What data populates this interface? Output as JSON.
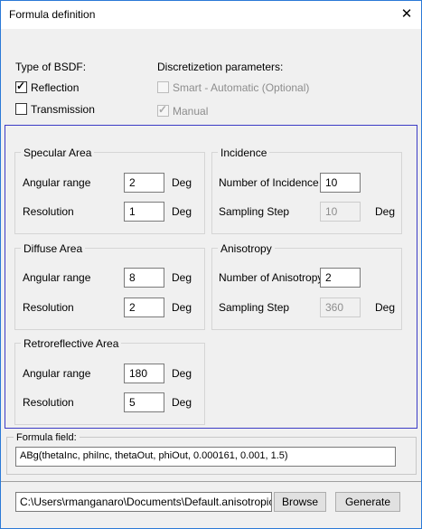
{
  "window": {
    "title": "Formula definition",
    "close_glyph": "✕"
  },
  "bsdf": {
    "label": "Type of BSDF:",
    "reflection": {
      "label": "Reflection",
      "checked": true
    },
    "transmission": {
      "label": "Transmission",
      "checked": false
    }
  },
  "discretization": {
    "label": "Discretizetion parameters:",
    "smart": {
      "label": "Smart - Automatic (Optional)",
      "checked": false,
      "enabled": false
    },
    "manual": {
      "label": "Manual",
      "checked": true,
      "enabled": false
    }
  },
  "specular": {
    "title": "Specular Area",
    "angular_label": "Angular range",
    "angular_value": "2",
    "angular_unit": "Deg",
    "resolution_label": "Resolution",
    "resolution_value": "1",
    "resolution_unit": "Deg"
  },
  "diffuse": {
    "title": "Diffuse Area",
    "angular_label": "Angular range",
    "angular_value": "8",
    "angular_unit": "Deg",
    "resolution_label": "Resolution",
    "resolution_value": "2",
    "resolution_unit": "Deg"
  },
  "retro": {
    "title": "Retroreflective Area",
    "angular_label": "Angular range",
    "angular_value": "180",
    "angular_unit": "Deg",
    "resolution_label": "Resolution",
    "resolution_value": "5",
    "resolution_unit": "Deg"
  },
  "incidence": {
    "title": "Incidence",
    "number_label": "Number of Incidence",
    "number_value": "10",
    "step_label": "Sampling Step",
    "step_value": "10",
    "step_unit": "Deg"
  },
  "anisotropy": {
    "title": "Anisotropy",
    "number_label": "Number of Anisotropy",
    "number_value": "2",
    "step_label": "Sampling Step",
    "step_value": "360",
    "step_unit": "Deg"
  },
  "formula": {
    "title": "Formula field:",
    "value": "ABg(thetaInc, phiInc, thetaOut, phiOut, 0.000161, 0.001, 1.5)"
  },
  "footer": {
    "path_value": "C:\\Users\\rmanganaro\\Documents\\Default.anisotropicbsdf",
    "browse_label": "Browse",
    "generate_label": "Generate"
  }
}
